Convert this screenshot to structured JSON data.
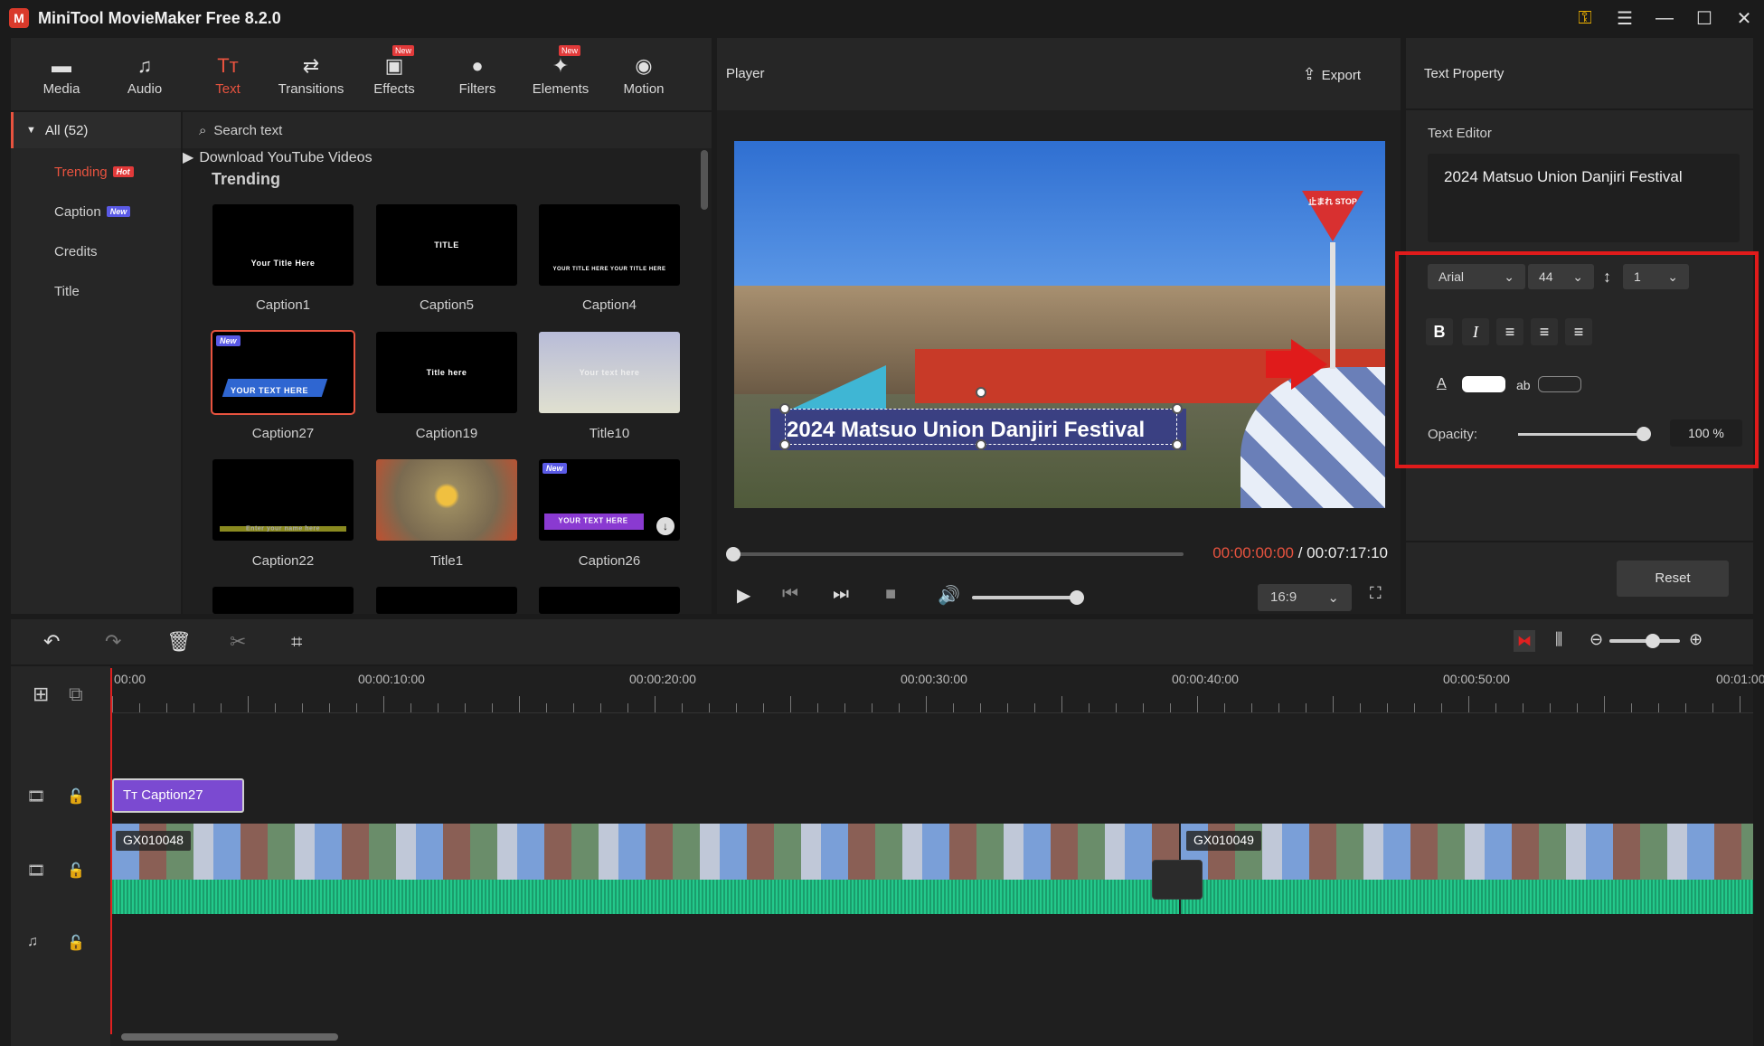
{
  "app": {
    "title": "MiniTool MovieMaker Free 8.2.0",
    "logo": "M"
  },
  "window_icons": [
    "key-icon",
    "menu-icon",
    "minimize-icon",
    "maximize-icon",
    "close-icon"
  ],
  "window_glyphs": {
    "key": "⚿",
    "menu": "☰",
    "min": "—",
    "max": "☐",
    "close": "✕"
  },
  "media_tabs": [
    {
      "label": "Media",
      "icon": "▬"
    },
    {
      "label": "Audio",
      "icon": "♫"
    },
    {
      "label": "Text",
      "icon": "Tт"
    },
    {
      "label": "Transitions",
      "icon": "⇄"
    },
    {
      "label": "Effects",
      "icon": "▣",
      "badge": "New"
    },
    {
      "label": "Filters",
      "icon": "●"
    },
    {
      "label": "Elements",
      "icon": "✦",
      "badge": "New"
    },
    {
      "label": "Motion",
      "icon": "◉"
    }
  ],
  "categories": {
    "all": "All (52)",
    "items": [
      {
        "label": "Trending",
        "badge": "Hot"
      },
      {
        "label": "Caption",
        "badge": "New"
      },
      {
        "label": "Credits"
      },
      {
        "label": "Title"
      }
    ]
  },
  "grid": {
    "search": "Search text",
    "download": "Download YouTube Videos",
    "section": "Trending",
    "items": [
      {
        "label": "Caption1",
        "text": "Your  Title Here"
      },
      {
        "label": "Caption5",
        "text": "TITLE"
      },
      {
        "label": "Caption4",
        "text": "YOUR TITLE HERE YOUR TITLE HERE"
      },
      {
        "label": "Caption27",
        "text": "YOUR TEXT HERE",
        "badge": "New"
      },
      {
        "label": "Caption19",
        "text": "Title here"
      },
      {
        "label": "Title10",
        "text": "Your text here"
      },
      {
        "label": "Caption22",
        "text": "Enter your name here"
      },
      {
        "label": "Title1",
        "text": ""
      },
      {
        "label": "Caption26",
        "text": "YOUR TEXT HERE",
        "badge": "New"
      }
    ]
  },
  "player": {
    "title": "Player",
    "export": "Export",
    "overlay_text": "2024 Matsuo Union Danjiri Festival",
    "time_current": "00:00:00:00",
    "time_total": "/ 00:07:17:10",
    "ratio": "16:9",
    "sign": "止まれ STOP"
  },
  "text_property": {
    "title": "Text Property",
    "editor_label": "Text Editor",
    "editor_value": "2024 Matsuo Union Danjiri Festival",
    "font": "Arial",
    "size": "44",
    "line_spacing": "1",
    "format_buttons": [
      "B",
      "I",
      "≡",
      "≡",
      "≡"
    ],
    "color_label": "A",
    "bg_label": "ab",
    "opacity_label": "Opacity:",
    "opacity_value": "100 %",
    "opacity_fraction": 1.0,
    "reset": "Reset"
  },
  "timeline": {
    "ruler": [
      "00:00",
      "00:00:10:00",
      "00:00:20:00",
      "00:00:30:00",
      "00:00:40:00",
      "00:00:50:00",
      "00:01:00"
    ],
    "caption_clip": "Tт Caption27",
    "video_clips": [
      "GX010048",
      "GX010049"
    ]
  },
  "colors": {
    "accent": "#e8533f",
    "highlight": "#e01b1b",
    "caption_clip": "#7b4ad1",
    "audio": "#23c98b"
  }
}
